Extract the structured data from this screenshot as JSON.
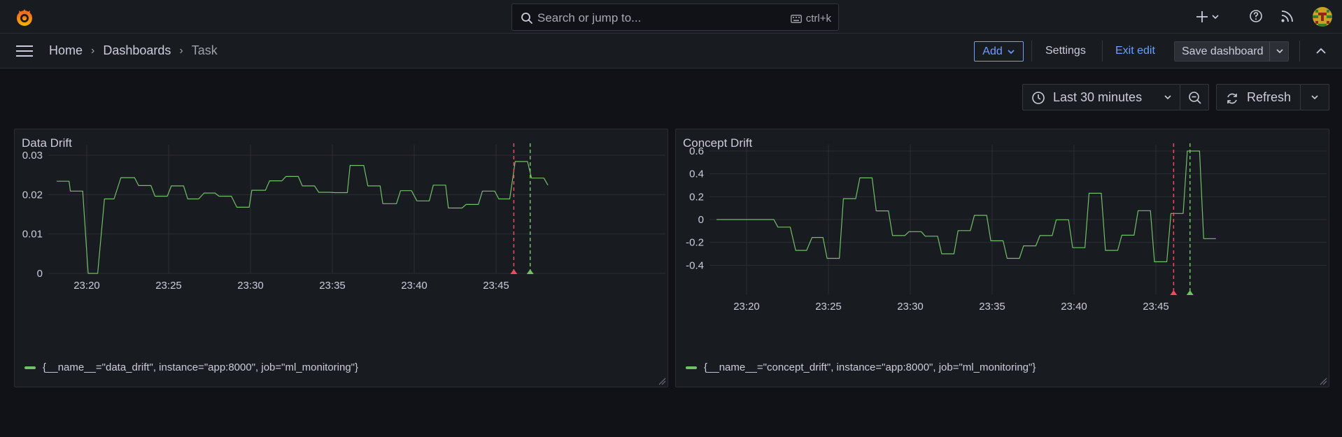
{
  "topbar": {
    "search_placeholder": "Search or jump to...",
    "shortcut": "ctrl+k",
    "icons": [
      "grafana-logo-icon",
      "search-icon",
      "keyboard-icon",
      "plus-icon",
      "help-icon",
      "news-icon",
      "avatar"
    ]
  },
  "breadcrumb": [
    "Home",
    "Dashboards",
    "Task"
  ],
  "toolbar": {
    "add_label": "Add",
    "settings_label": "Settings",
    "exit_label": "Exit edit",
    "save_label": "Save dashboard"
  },
  "time": {
    "range_label": "Last 30 minutes",
    "refresh_label": "Refresh"
  },
  "colors": {
    "series": "#73bf69",
    "annotation_red": "#f2495c",
    "annotation_green": "#73bf69",
    "accent": "#6e9fff"
  },
  "panels": [
    {
      "title": "Data Drift",
      "legend": "{__name__=\"data_drift\", instance=\"app:8000\", job=\"ml_monitoring\"}"
    },
    {
      "title": "Concept Drift",
      "legend": "{__name__=\"concept_drift\", instance=\"app:8000\", job=\"ml_monitoring\"}"
    }
  ],
  "chart_data": [
    {
      "type": "line",
      "title": "Data Drift",
      "series": [
        {
          "name": "{__name__=\"data_drift\", instance=\"app:8000\", job=\"ml_monitoring\"}",
          "x": [
            "23:18:10",
            "23:18:55",
            "23:19:00",
            "23:19:45",
            "23:20:05",
            "23:20:40",
            "23:21:05",
            "23:21:40",
            "23:22:05",
            "23:22:55",
            "23:23:10",
            "23:23:55",
            "23:24:10",
            "23:24:55",
            "23:25:10",
            "23:25:55",
            "23:26:10",
            "23:26:50",
            "23:27:10",
            "23:27:50",
            "23:28:05",
            "23:28:50",
            "23:29:10",
            "23:29:55",
            "23:30:05",
            "23:30:55",
            "23:31:10",
            "23:31:55",
            "23:32:10",
            "23:32:55",
            "23:33:10",
            "23:33:55",
            "23:34:10",
            "23:34:50",
            "23:35:10",
            "23:35:55",
            "23:36:05",
            "23:36:55",
            "23:37:10",
            "23:37:55",
            "23:38:05",
            "23:38:55",
            "23:39:10",
            "23:39:50",
            "23:40:10",
            "23:40:55",
            "23:41:10",
            "23:41:55",
            "23:42:05",
            "23:42:55",
            "23:43:10",
            "23:43:55",
            "23:44:10",
            "23:44:55",
            "23:45:10",
            "23:45:50",
            "23:46:10",
            "23:46:55",
            "23:47:10",
            "23:47:55",
            "23:48:10"
          ],
          "values": [
            0.0234,
            0.0234,
            0.0209,
            0.0209,
            0.0,
            0.0,
            0.0189,
            0.0189,
            0.0243,
            0.0243,
            0.0223,
            0.0223,
            0.0196,
            0.0196,
            0.0222,
            0.0222,
            0.0189,
            0.0189,
            0.0204,
            0.0204,
            0.0196,
            0.0196,
            0.0168,
            0.0168,
            0.0211,
            0.0211,
            0.0235,
            0.0235,
            0.0246,
            0.0246,
            0.0222,
            0.0222,
            0.0206,
            0.0206,
            0.0205,
            0.0205,
            0.0274,
            0.0274,
            0.0222,
            0.0222,
            0.0177,
            0.0177,
            0.021,
            0.021,
            0.0184,
            0.0184,
            0.0224,
            0.0224,
            0.0166,
            0.0166,
            0.0175,
            0.0175,
            0.0209,
            0.0209,
            0.0189,
            0.0189,
            0.0284,
            0.0284,
            0.0242,
            0.0242,
            0.0224
          ]
        }
      ],
      "xticks": [
        "23:20",
        "23:25",
        "23:30",
        "23:35",
        "23:40",
        "23:45"
      ],
      "yticks": [
        0,
        0.01,
        0.02,
        0.03
      ],
      "ylim": [
        0,
        0.03
      ],
      "annotations": [
        {
          "time": "23:46:05",
          "color": "red"
        },
        {
          "time": "23:47:05",
          "color": "green"
        }
      ],
      "grid": true,
      "legend_position": "bottom-left"
    },
    {
      "type": "line",
      "title": "Concept Drift",
      "series": [
        {
          "name": "{__name__=\"concept_drift\", instance=\"app:8000\", job=\"ml_monitoring\"}",
          "x": [
            "23:18:10",
            "23:21:40",
            "23:21:55",
            "23:22:40",
            "23:23:00",
            "23:23:40",
            "23:24:00",
            "23:24:40",
            "23:24:55",
            "23:25:40",
            "23:25:55",
            "23:26:40",
            "23:26:55",
            "23:27:40",
            "23:27:55",
            "23:28:40",
            "23:28:55",
            "23:29:40",
            "23:29:55",
            "23:30:40",
            "23:30:55",
            "23:31:40",
            "23:31:55",
            "23:32:40",
            "23:32:55",
            "23:33:40",
            "23:33:55",
            "23:34:40",
            "23:34:55",
            "23:35:40",
            "23:35:55",
            "23:36:40",
            "23:36:55",
            "23:37:40",
            "23:37:55",
            "23:38:40",
            "23:38:55",
            "23:39:40",
            "23:39:55",
            "23:40:40",
            "23:40:55",
            "23:41:40",
            "23:41:55",
            "23:42:40",
            "23:42:55",
            "23:43:40",
            "23:43:55",
            "23:44:40",
            "23:44:55",
            "23:45:40",
            "23:45:55",
            "23:46:40",
            "23:46:55",
            "23:47:40",
            "23:47:55",
            "23:48:40"
          ],
          "values": [
            0.0,
            0.0,
            -0.066,
            -0.066,
            -0.27,
            -0.27,
            -0.157,
            -0.157,
            -0.34,
            -0.34,
            0.183,
            0.183,
            0.365,
            0.365,
            0.076,
            0.076,
            -0.14,
            -0.14,
            -0.106,
            -0.106,
            -0.146,
            -0.146,
            -0.3,
            -0.3,
            -0.097,
            -0.097,
            0.037,
            0.037,
            -0.186,
            -0.186,
            -0.34,
            -0.34,
            -0.23,
            -0.23,
            -0.14,
            -0.14,
            -0.002,
            -0.002,
            -0.246,
            -0.246,
            0.23,
            0.23,
            -0.27,
            -0.27,
            -0.137,
            -0.137,
            0.078,
            0.078,
            -0.37,
            -0.37,
            0.053,
            0.053,
            0.6,
            0.6,
            -0.167,
            -0.167
          ]
        }
      ],
      "xticks": [
        "23:20",
        "23:25",
        "23:30",
        "23:35",
        "23:40",
        "23:45"
      ],
      "yticks": [
        -0.4,
        -0.2,
        0,
        0.2,
        0.4,
        0.6
      ],
      "ylim": [
        -0.45,
        0.6
      ],
      "annotations": [
        {
          "time": "23:46:05",
          "color": "red"
        },
        {
          "time": "23:47:05",
          "color": "green"
        }
      ],
      "grid": true,
      "legend_position": "bottom-left"
    }
  ]
}
